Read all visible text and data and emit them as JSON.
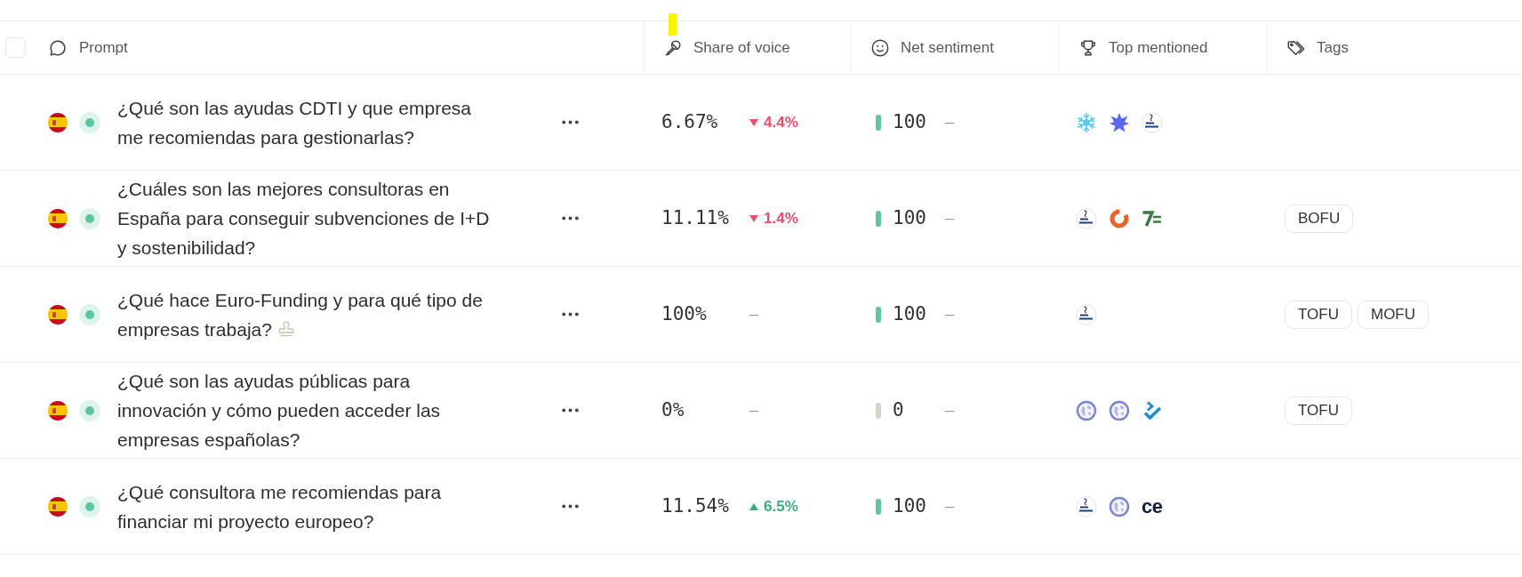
{
  "table": {
    "select_all": {
      "checked": false
    },
    "columns": [
      {
        "kind": "prompt",
        "label": "Prompt"
      },
      {
        "kind": "share",
        "label": "Share of voice"
      },
      {
        "kind": "sentiment",
        "label": "Net sentiment"
      },
      {
        "kind": "top",
        "label": "Top mentioned"
      },
      {
        "kind": "tags",
        "label": "Tags"
      }
    ],
    "rows": [
      {
        "prompt": "¿Qué son las ayudas CDTI y que empresa me recomiendas para gestionarlas?",
        "stamped": false,
        "share": "6.67%",
        "change": {
          "kind": "down",
          "text": "4.4%"
        },
        "sentiment": {
          "kind": "positive",
          "value": "100",
          "change": "–"
        },
        "top_mentioned": [
          {
            "kind": "snowflake"
          },
          {
            "kind": "star"
          },
          {
            "kind": "round"
          }
        ]
      },
      {
        "prompt": "¿Cuáles son las mejores consultoras en España para conseguir subvenciones de I+D y sostenibilidad?",
        "stamped": false,
        "share": "11.11%",
        "change": {
          "kind": "down",
          "text": "1.4%"
        },
        "sentiment": {
          "kind": "positive",
          "value": "100",
          "change": "–"
        },
        "top_mentioned": [
          {
            "kind": "round"
          },
          {
            "kind": "ring"
          },
          {
            "kind": "seven"
          }
        ],
        "tags": [
          "BOFU"
        ]
      },
      {
        "prompt": "¿Qué hace Euro-Funding y para qué tipo de empresas trabaja?",
        "stamped": true,
        "share": "100%",
        "change": {
          "kind": "none",
          "text": "–"
        },
        "sentiment": {
          "kind": "positive",
          "value": "100",
          "change": "–"
        },
        "top_mentioned": [
          {
            "kind": "round"
          }
        ],
        "tags": [
          "TOFU",
          "MOFU"
        ]
      },
      {
        "prompt": "¿Qué son las ayudas públicas para innovación y cómo pueden acceder las empresas españolas?",
        "stamped": false,
        "share": "0%",
        "change": {
          "kind": "none",
          "text": "–"
        },
        "sentiment": {
          "kind": "neutral",
          "value": "0",
          "change": "–"
        },
        "top_mentioned": [
          {
            "kind": "globe"
          },
          {
            "kind": "globe"
          },
          {
            "kind": "check"
          }
        ],
        "tags": [
          "TOFU"
        ]
      },
      {
        "prompt": "¿Qué consultora me recomiendas para financiar mi proyecto europeo?",
        "stamped": false,
        "share": "11.54%",
        "change": {
          "kind": "up",
          "text": "6.5%"
        },
        "sentiment": {
          "kind": "positive",
          "value": "100",
          "change": "–"
        },
        "top_mentioned": [
          {
            "kind": "round"
          },
          {
            "kind": "globe"
          },
          {
            "kind": "wordmark",
            "text": "ce"
          }
        ]
      }
    ]
  }
}
